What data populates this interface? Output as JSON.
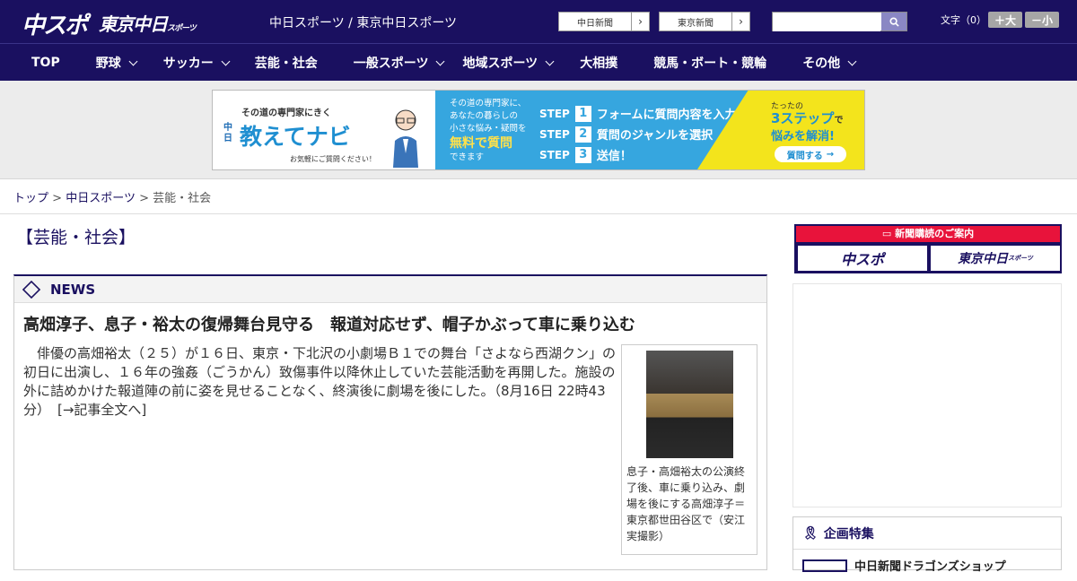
{
  "header": {
    "logo_chunichi": "中スポ",
    "logo_tokyo": "東京中日",
    "logo_tokyo_sub": "スポーツ",
    "site_links": "中日スポーツ / 東京中日スポーツ",
    "paper_buttons": [
      "中日新聞",
      "東京新聞"
    ],
    "search_placeholder": "",
    "font_size_label": "文字（0）",
    "font_larger": "＋大",
    "font_smaller": "－小"
  },
  "nav": {
    "items": [
      {
        "label": "TOP",
        "dropdown": false
      },
      {
        "label": "野球",
        "dropdown": true
      },
      {
        "label": "サッカー",
        "dropdown": true
      },
      {
        "label": "芸能・社会",
        "dropdown": false
      },
      {
        "label": "一般スポーツ",
        "dropdown": true
      },
      {
        "label": "地域スポーツ",
        "dropdown": true
      },
      {
        "label": "大相撲",
        "dropdown": false
      },
      {
        "label": "競馬・ボート・競輪",
        "dropdown": false
      },
      {
        "label": "その他",
        "dropdown": true
      }
    ]
  },
  "banner": {
    "tagline": "その道の専門家にきく",
    "brand_prefix": "中日",
    "brand": "教えてナビ",
    "note": "お気軽にご質問ください！",
    "desc1": "その道の専門家に、",
    "desc2": "あなたの暮らしの",
    "desc3": "小さな悩み・疑問を",
    "free": "無料で質問",
    "desc4": "できます",
    "steps": [
      {
        "num": "1",
        "text": "フォームに質問内容を入力"
      },
      {
        "num": "2",
        "text": "質問のジャンルを選択"
      },
      {
        "num": "3",
        "text": "送信！"
      }
    ],
    "step_label": "STEP",
    "right1": "たったの",
    "right2": "3ステップ",
    "right2b": "で",
    "right3": "悩みを解消!",
    "cta": "質問する"
  },
  "breadcrumb": {
    "items": [
      "トップ",
      "中日スポーツ",
      "芸能・社会"
    ],
    "sep": ">"
  },
  "main": {
    "category_title": "【芸能・社会】",
    "section_label": "NEWS",
    "headline": "高畑淳子、息子・裕太の復帰舞台見守る　報道対応せず、帽子かぶって車に乗り込む",
    "body": "　俳優の高畑裕太（２５）が１６日、東京・下北沢の小劇場Ｂ１での舞台「さよなら西湖クン」の初日に出演し、１６年の強姦（ごうかん）致傷事件以降休止していた芸能活動を再開した。施設の外に詰めかけた報道陣の前に姿を見せることなく、終演後に劇場を後にした。（8月16日 22時43分）",
    "read_more": "[→記事全文へ]",
    "photo_caption": "息子・高畑裕太の公演終了後、車に乗り込み、劇場を後にする高畑淳子＝東京都世田谷区で（安江実撮影）"
  },
  "sidebar": {
    "subscribe_title": "新聞購読のご案内",
    "sub_logo1": "中スポ",
    "sub_logo2": "東京中日",
    "sub_logo2_small": "スポーツ",
    "feature_title": "企画特集",
    "feature_item": "中日新聞ドラゴンズショップ"
  },
  "colors": {
    "brand_navy": "#1a1060",
    "subscribe_red": "#e8133b",
    "banner_blue": "#36a6df",
    "banner_yellow": "#f3e41c"
  }
}
